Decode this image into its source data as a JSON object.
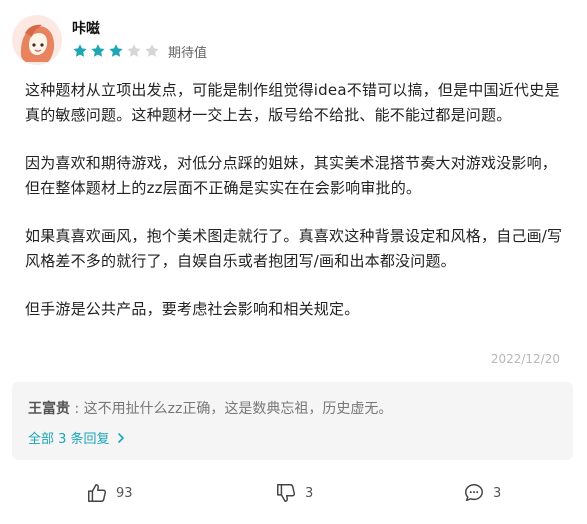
{
  "user": {
    "name": "咔嗞",
    "rating_stars": 3,
    "rating_max": 5,
    "rating_label": "期待值"
  },
  "content": {
    "paragraphs": [
      "这种题材从立项出发点，可能是制作组觉得idea不错可以搞，但是中国近代史是真的敏感问题。这种题材一交上去，版号给不给批、能不能过都是问题。",
      "因为喜欢和期待游戏，对低分点踩的姐妹，其实美术混搭节奏大对游戏没影响，但在整体题材上的zz层面不正确是实实在在会影响审批的。",
      "如果真喜欢画风，抱个美术图走就行了。真喜欢这种背景设定和风格，自己画/写风格差不多的就行了，自娱自乐或者抱团写/画和出本都没问题。",
      "但手游是公共产品，要考虑社会影响和相关规定。"
    ],
    "date": "2022/12/20"
  },
  "reply": {
    "author": "王富贵",
    "separator": ":",
    "text": "这不用扯什么zz正确，这是数典忘祖，历史虚无。",
    "more_label": "全部 3 条回复",
    "more_icon": "chevron-right-icon"
  },
  "actions": {
    "like_count": "93",
    "dislike_count": "3",
    "comment_count": "3"
  },
  "colors": {
    "star_filled": "#1ea7b3",
    "star_empty": "#d6d6d6",
    "link": "#1ca6b7"
  }
}
